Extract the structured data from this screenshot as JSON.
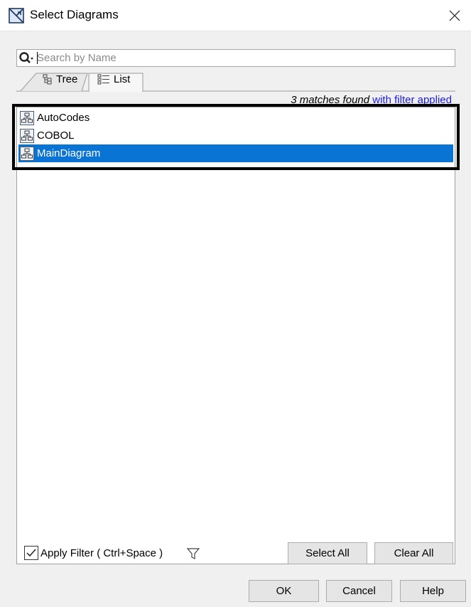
{
  "window": {
    "title": "Select Diagrams",
    "icon": "diagram-select-icon",
    "close_icon": "close-icon"
  },
  "search": {
    "placeholder": "Search by Name",
    "value": "",
    "icon": "search-icon"
  },
  "tabs": [
    {
      "label": "Tree",
      "icon": "tree-icon",
      "active": false
    },
    {
      "label": "List",
      "icon": "list-icon",
      "active": true
    }
  ],
  "matches": {
    "count_text": "3 matches found",
    "filter_text": "with filter applied"
  },
  "list": {
    "items": [
      {
        "label": "AutoCodes",
        "icon": "diagram-icon",
        "selected": false
      },
      {
        "label": "COBOL",
        "icon": "diagram-icon",
        "selected": false
      },
      {
        "label": "MainDiagram",
        "icon": "diagram-icon",
        "selected": true
      }
    ]
  },
  "filter": {
    "checked": true,
    "label": "Apply Filter ( Ctrl+Space )",
    "icon": "funnel-icon"
  },
  "buttons": {
    "select_all": "Select All",
    "clear_all": "Clear All",
    "ok": "OK",
    "cancel": "Cancel",
    "help": "Help"
  },
  "colors": {
    "selection": "#0a74d4",
    "link": "#1a1aee",
    "dialog_bg": "#f0f0f0"
  }
}
